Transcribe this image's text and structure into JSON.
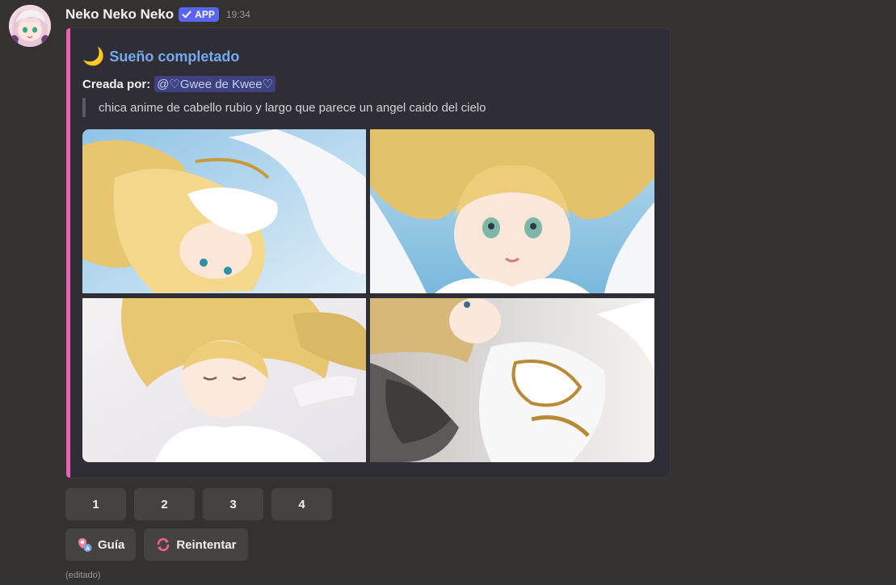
{
  "message": {
    "author": "Neko Neko Neko",
    "badge": "APP",
    "timestamp": "19:34",
    "edited_label": "(editado)"
  },
  "embed": {
    "accent_color": "#e862b3",
    "title": "Sueño completado",
    "title_emoji": "crescent-moon-icon",
    "field_label": "Creada por:",
    "mention": "@♡Gwee de Kwee♡",
    "prompt": "chica anime de cabello rubio y largo que parece un angel caido del cielo"
  },
  "buttons": {
    "numbers": [
      "1",
      "2",
      "3",
      "4"
    ],
    "guide": "Guía",
    "retry": "Reintentar"
  },
  "colors": {
    "background": "#35312e",
    "embed_bg": "#2f2e36",
    "title": "#74abf0",
    "badge": "#5865f2",
    "button_bg": "#46423f"
  }
}
